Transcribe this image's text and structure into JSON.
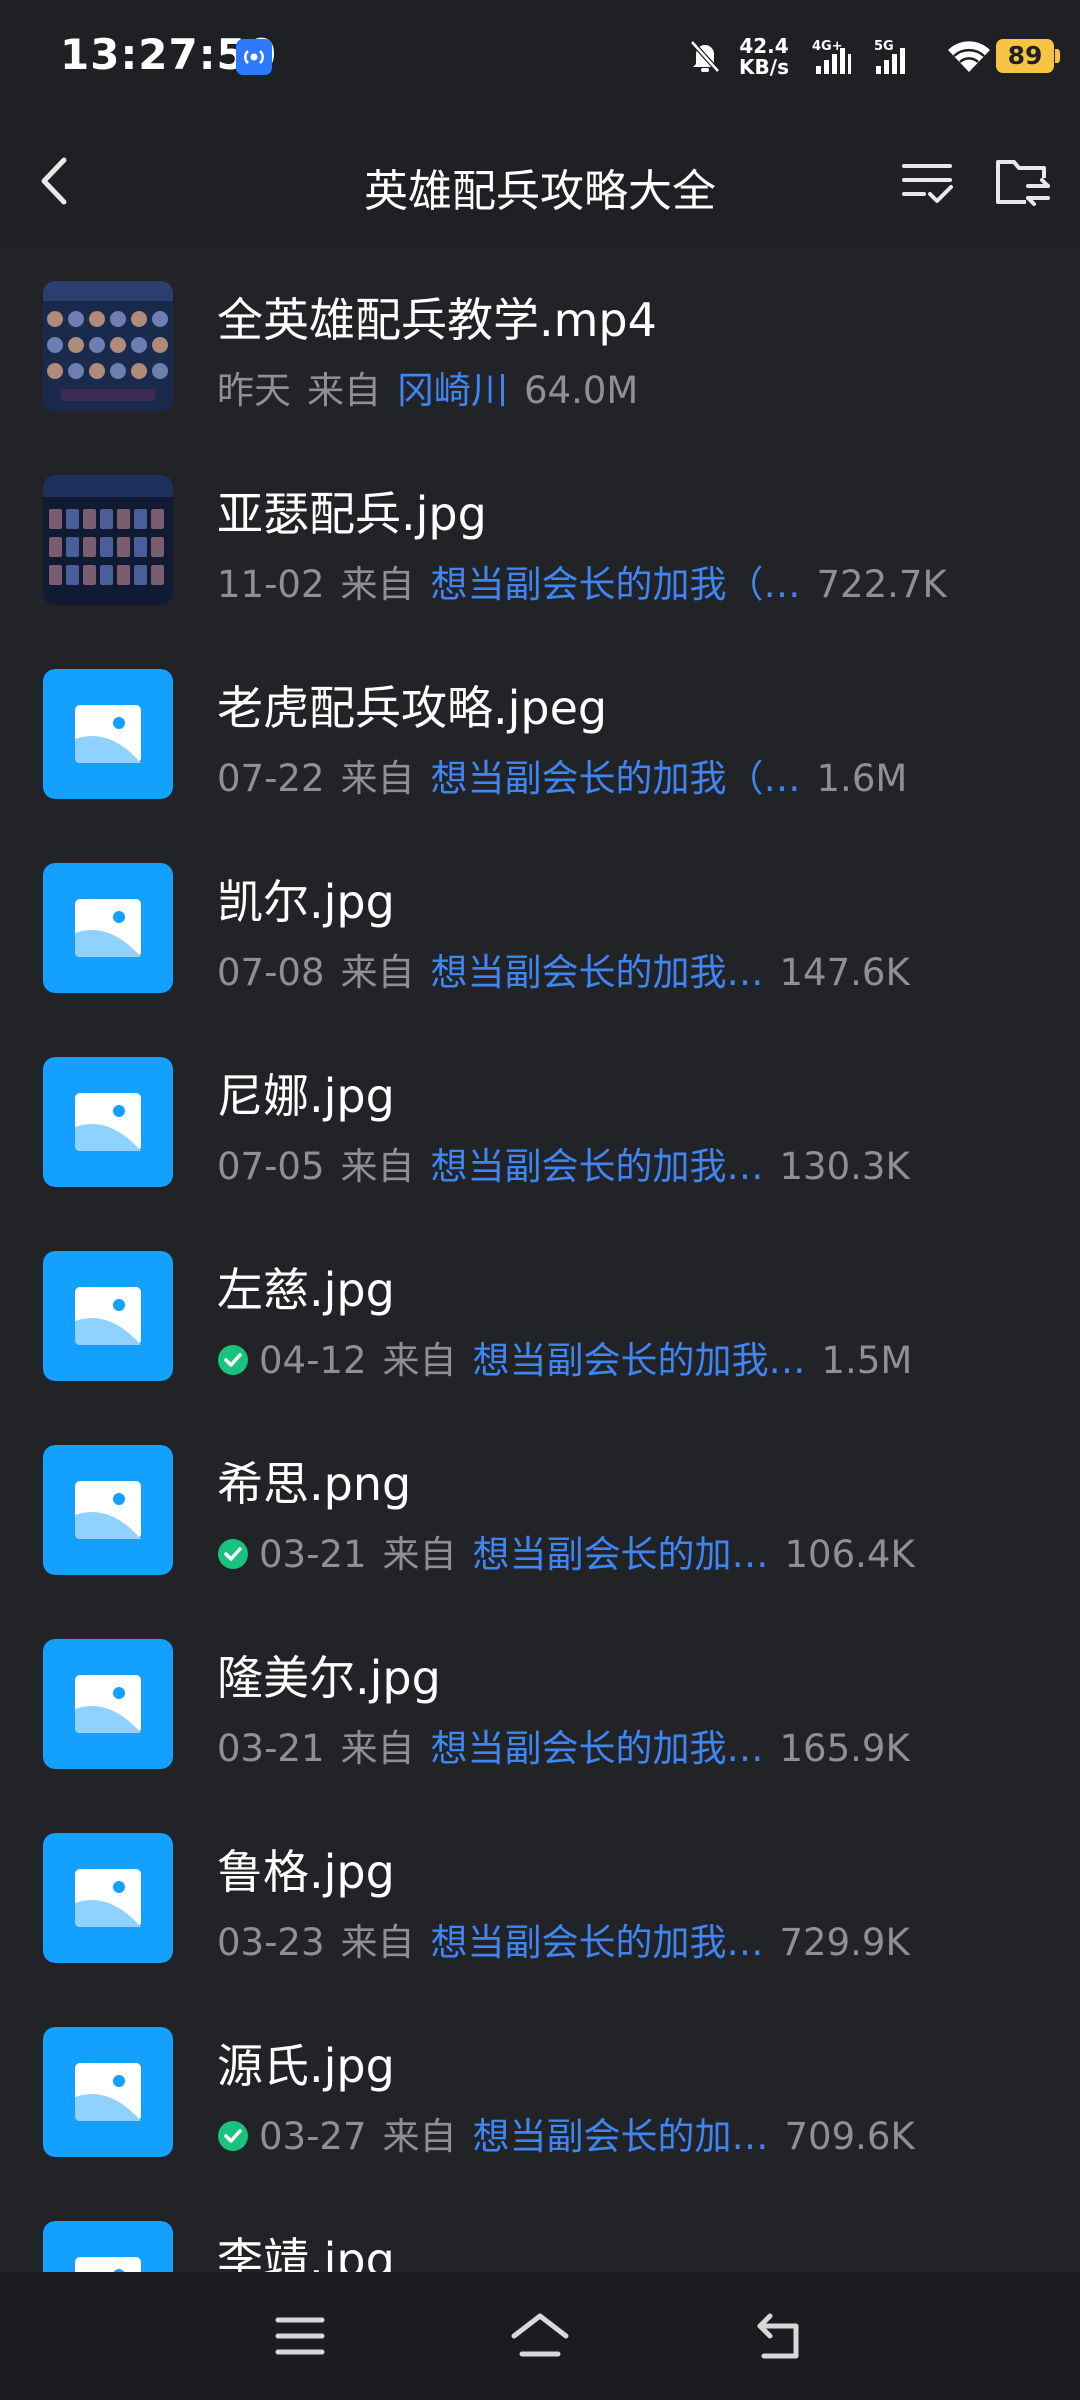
{
  "status": {
    "time": "13:27:50",
    "net_speed_value": "42.4",
    "net_speed_unit": "KB/s",
    "signal1_label": "4G+",
    "signal2_label": "5G",
    "battery": "89"
  },
  "header": {
    "title": "英雄配兵攻略大全"
  },
  "files": [
    {
      "name": "全英雄配兵教学.mp4",
      "date": "昨天",
      "from_label": "来自",
      "sender": "冈崎川",
      "size": "64.0M",
      "synced": false,
      "thumb": "video"
    },
    {
      "name": "亚瑟配兵.jpg",
      "date": "11-02",
      "from_label": "来自",
      "sender": "想当副会长的加我（…",
      "size": "722.7K",
      "synced": false,
      "thumb": "photo"
    },
    {
      "name": "老虎配兵攻略.jpeg",
      "date": "07-22",
      "from_label": "来自",
      "sender": "想当副会长的加我（…",
      "size": "1.6M",
      "synced": false,
      "thumb": "icon"
    },
    {
      "name": "凯尔.jpg",
      "date": "07-08",
      "from_label": "来自",
      "sender": "想当副会长的加我…",
      "size": "147.6K",
      "synced": false,
      "thumb": "icon"
    },
    {
      "name": "尼娜.jpg",
      "date": "07-05",
      "from_label": "来自",
      "sender": "想当副会长的加我…",
      "size": "130.3K",
      "synced": false,
      "thumb": "icon"
    },
    {
      "name": "左慈.jpg",
      "date": "04-12",
      "from_label": "来自",
      "sender": "想当副会长的加我…",
      "size": "1.5M",
      "synced": true,
      "thumb": "icon"
    },
    {
      "name": "希思.png",
      "date": "03-21",
      "from_label": "来自",
      "sender": "想当副会长的加…",
      "size": "106.4K",
      "synced": true,
      "thumb": "icon"
    },
    {
      "name": "隆美尔.jpg",
      "date": "03-21",
      "from_label": "来自",
      "sender": "想当副会长的加我…",
      "size": "165.9K",
      "synced": false,
      "thumb": "icon"
    },
    {
      "name": "鲁格.jpg",
      "date": "03-23",
      "from_label": "来自",
      "sender": "想当副会长的加我…",
      "size": "729.9K",
      "synced": false,
      "thumb": "icon"
    },
    {
      "name": "源氏.jpg",
      "date": "03-27",
      "from_label": "来自",
      "sender": "想当副会长的加…",
      "size": "709.6K",
      "synced": true,
      "thumb": "icon"
    },
    {
      "name": "李靖.jpg",
      "date": "",
      "from_label": "",
      "sender": "",
      "size": "",
      "synced": false,
      "thumb": "icon"
    }
  ],
  "colors": {
    "background": "#222326",
    "accent_link": "#3f86f4",
    "image_icon_bg": "#14a0ff",
    "synced_check": "#19c37d",
    "battery": "#f6c342"
  }
}
